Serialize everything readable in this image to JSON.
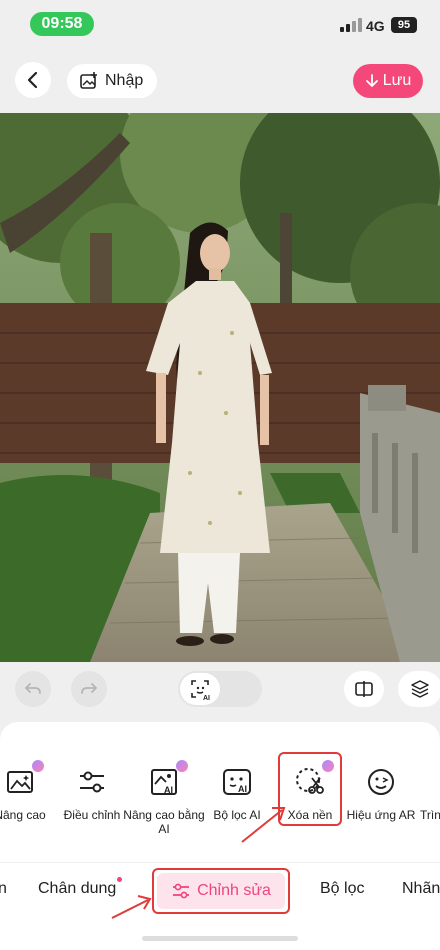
{
  "status_bar": {
    "time": "09:58",
    "network": "4G",
    "battery": "95"
  },
  "top_bar": {
    "import_label": "Nhập",
    "save_label": "Lưu"
  },
  "colors": {
    "accent": "#f5487a",
    "highlight": "#e03a3a",
    "status_green": "#34c759"
  },
  "tools": [
    {
      "label": "Nâng cao",
      "icon": "enhance-image-icon",
      "premium": true
    },
    {
      "label": "Điều chỉnh",
      "icon": "adjust-sliders-icon",
      "premium": false
    },
    {
      "label": "Nâng cao bằng AI",
      "icon": "ai-enhance-icon",
      "premium": true
    },
    {
      "label": "Bộ lọc AI",
      "icon": "ai-filter-icon",
      "premium": false
    },
    {
      "label": "Xóa nền",
      "icon": "remove-background-icon",
      "premium": true
    },
    {
      "label": "Hiệu ứng AR",
      "icon": "ar-effect-icon",
      "premium": false
    },
    {
      "label": "Trìn",
      "icon": "more-tool-icon",
      "premium": false
    }
  ],
  "tabs": [
    {
      "label": "n"
    },
    {
      "label": "Chân dung"
    },
    {
      "label": "Chỉnh sửa",
      "active": true
    },
    {
      "label": "Bộ lọc"
    },
    {
      "label": "Nhãn"
    }
  ]
}
